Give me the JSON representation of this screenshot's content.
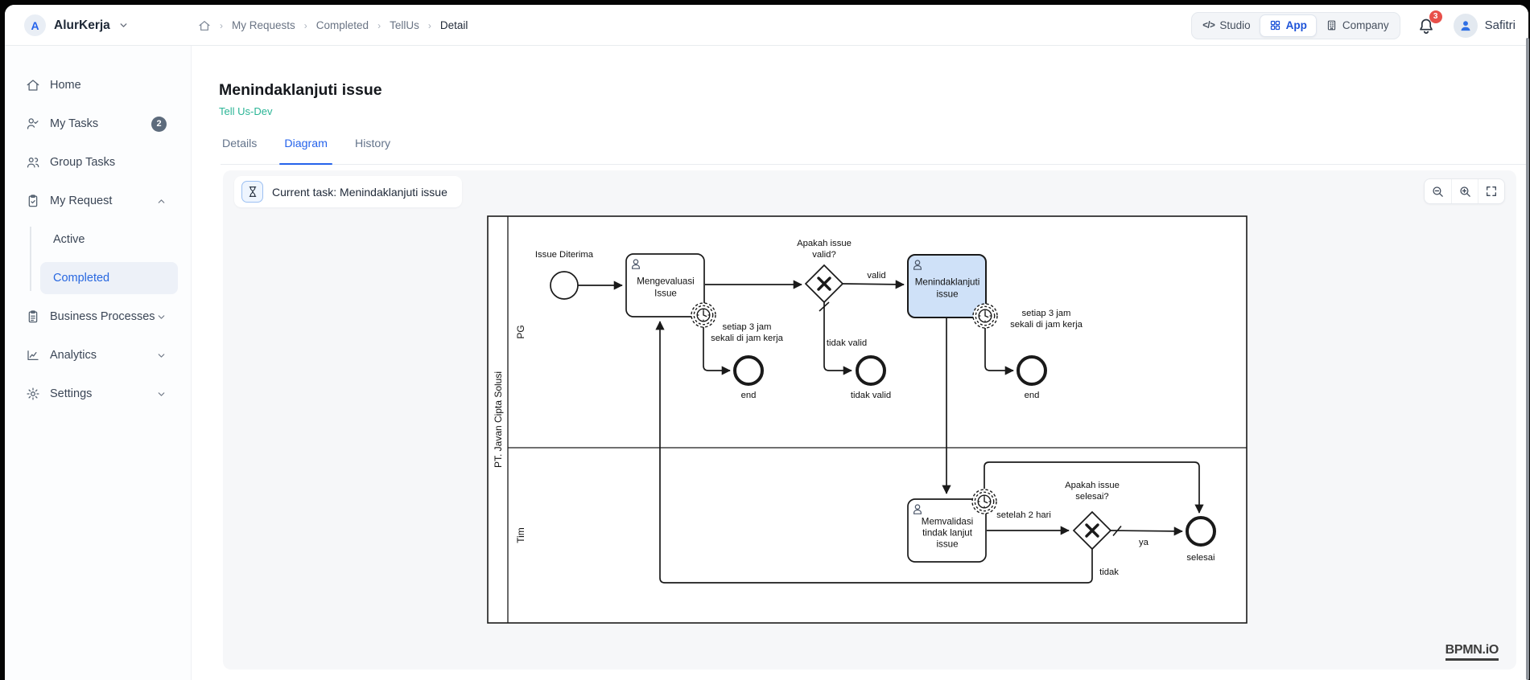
{
  "topbar": {
    "brand_initial": "A",
    "brand_name": "AlurKerja",
    "breadcrumb": [
      "My Requests",
      "Completed",
      "TellUs",
      "Detail"
    ],
    "studio_label": "Studio",
    "app_label": "App",
    "company_label": "Company",
    "notification_count": "3",
    "user_name": "Safitri"
  },
  "sidebar": {
    "items": [
      {
        "label": "Home"
      },
      {
        "label": "My Tasks",
        "badge": "2"
      },
      {
        "label": "Group Tasks"
      },
      {
        "label": "My Request"
      },
      {
        "label": "Business Processes"
      },
      {
        "label": "Analytics"
      },
      {
        "label": "Settings"
      }
    ],
    "my_request_children": [
      {
        "label": "Active"
      },
      {
        "label": "Completed"
      }
    ]
  },
  "page": {
    "title": "Menindaklanjuti issue",
    "subtitle": "Tell Us-Dev",
    "tabs": [
      "Details",
      "Diagram",
      "History"
    ],
    "active_tab": "Diagram"
  },
  "diagram": {
    "current_task_banner": "Current task: Menindaklanjuti issue",
    "watermark": "BPMN.iO",
    "pool_label": "PT. Javan Cipta Solusi",
    "lane_labels": [
      "PG",
      "Tim"
    ],
    "start_event_label": "Issue Diterima",
    "task_evaluate": [
      "Mengevaluasi",
      "Issue"
    ],
    "timer_evaluate": [
      "setiap 3 jam",
      "sekali di jam kerja"
    ],
    "end_evaluate_label": "end",
    "gateway_valid": [
      "Apakah issue",
      "valid?"
    ],
    "flow_valid_label": "valid",
    "flow_tidak_valid_label": "tidak valid",
    "end_tidak_valid_label": "tidak valid",
    "task_followup": [
      "Menindaklanjuti",
      "issue"
    ],
    "timer_followup": [
      "setiap 3 jam",
      "sekali di jam kerja"
    ],
    "end_followup_label": "end",
    "task_validate": [
      "Memvalidasi",
      "tindak lanjut",
      "issue"
    ],
    "timer_validate_label": "setelah 2 hari",
    "gateway_done": [
      "Apakah issue",
      "selesai?"
    ],
    "flow_ya_label": "ya",
    "flow_tidak_label": "tidak",
    "end_selesai_label": "selesai"
  },
  "colors": {
    "accent_blue": "#2563eb",
    "highlight_task_fill": "#cfe1f8",
    "subtitle_teal": "#2bb596",
    "notification_red": "#e8504a"
  }
}
